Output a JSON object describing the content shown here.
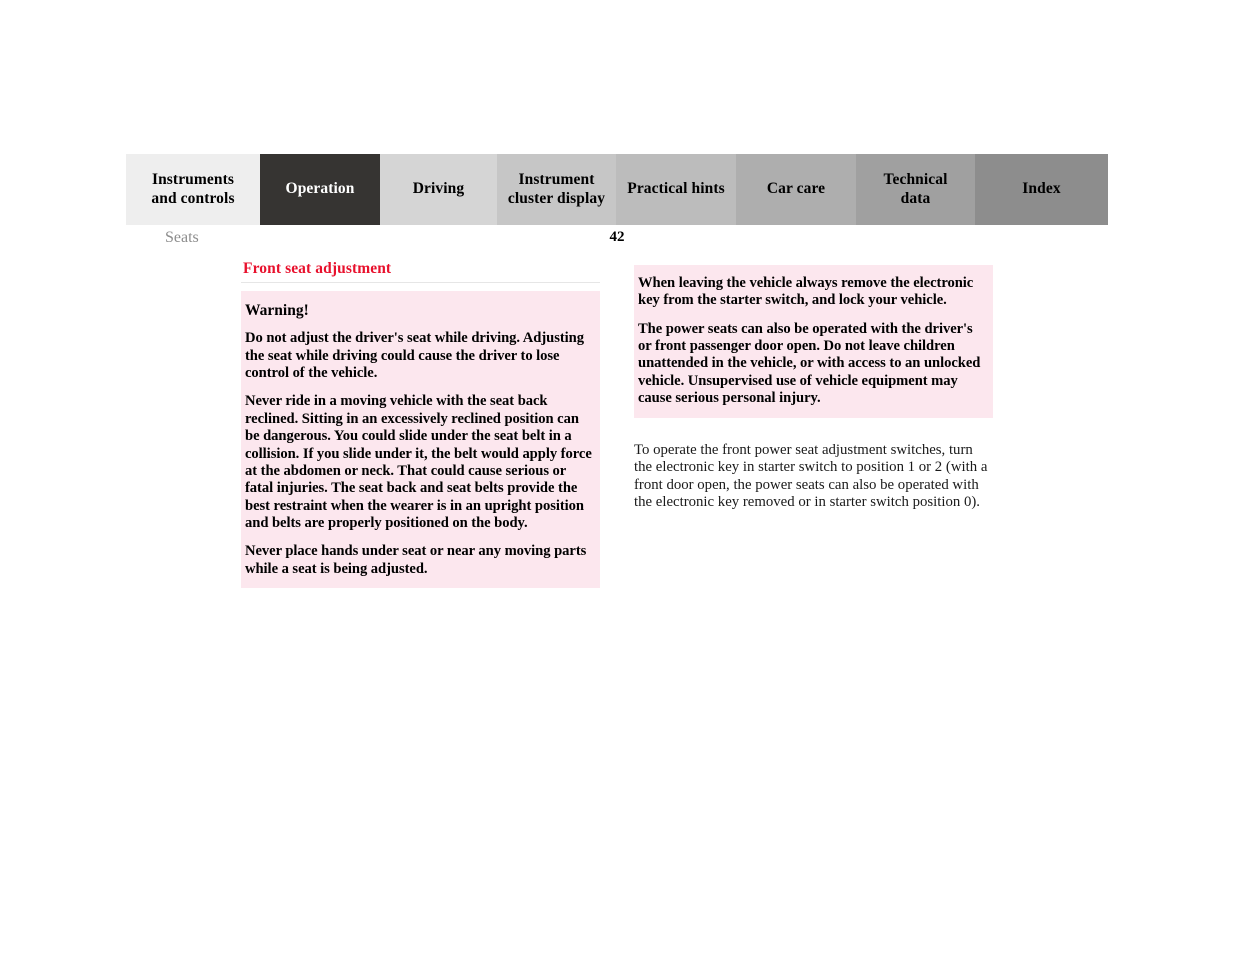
{
  "tab_bar": {
    "tabs": [
      {
        "label": "Instruments\nand controls",
        "bg": "#eeeeee",
        "active": false
      },
      {
        "label": "Operation",
        "bg": "#363432",
        "active": true
      },
      {
        "label": "Driving",
        "bg": "#d5d5d5",
        "active": false
      },
      {
        "label": "Instrument\ncluster display",
        "bg": "#c6c6c6",
        "active": false
      },
      {
        "label": "Practical hints",
        "bg": "#bcbcbc",
        "active": false
      },
      {
        "label": "Car care",
        "bg": "#aeaeae",
        "active": false
      },
      {
        "label": "Technical\ndata",
        "bg": "#a0a0a0",
        "active": false
      },
      {
        "label": "Index",
        "bg": "#8d8d8d",
        "active": false
      }
    ]
  },
  "running_header": {
    "section": "Seats",
    "page_number": "42"
  },
  "left_column": {
    "heading": "Front seat adjustment",
    "warning": {
      "title": "Warning!",
      "paragraphs": [
        "Do not adjust the driver's seat while driving. Adjusting the seat while driving could cause the driver to lose control of the vehicle.",
        "Never ride in a moving vehicle with the seat back reclined. Sitting in an excessively reclined position can be dangerous. You could slide under the seat belt in a collision. If you slide under it, the belt would apply force at the abdomen or neck. That could cause serious or fatal injuries. The seat back and seat belts provide the best restraint when the wearer is in an upright position and belts are properly positioned on the body.",
        "Never place hands under seat or near any moving parts while a seat is being adjusted."
      ]
    }
  },
  "right_column": {
    "warning": {
      "paragraphs": [
        "When leaving the vehicle always remove the electronic key from the starter switch, and lock your vehicle.",
        "The power seats can also be operated with the driver's or front passenger door open. Do not leave children unattended in the vehicle, or with access to an unlocked vehicle. Unsupervised use of vehicle equipment may cause serious personal injury."
      ]
    },
    "body": "To operate the front power seat adjustment switches, turn the electronic key in starter switch to position 1 or 2 (with a front door open, the power seats can also be operated with the electronic key removed or in starter switch position 0)."
  },
  "colors": {
    "heading_red": "#e8112d",
    "warning_bg": "#fce7ee",
    "active_tab_bg": "#363432",
    "running_header_gray": "#8d8d8d"
  }
}
